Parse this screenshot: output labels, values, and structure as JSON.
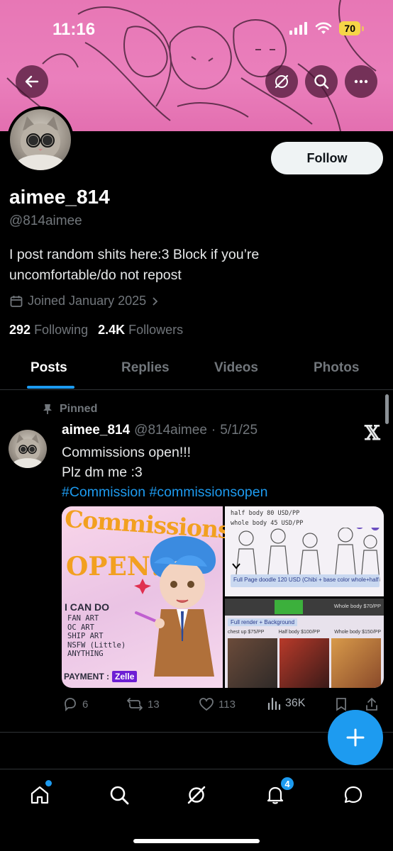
{
  "status_bar": {
    "time": "11:16",
    "battery": "70"
  },
  "profile": {
    "display_name": "aimee_814",
    "handle": "@814aimee",
    "bio_line1": "I post random shits here:3 Block if you’re",
    "bio_line2": "uncomfortable/do not repost",
    "joined": "Joined January 2025",
    "following_count": "292",
    "following_label": "Following",
    "followers_count": "2.4K",
    "followers_label": "Followers",
    "follow_button": "Follow"
  },
  "tabs": [
    "Posts",
    "Replies",
    "Videos",
    "Photos"
  ],
  "pinned_post": {
    "pinned_label": "Pinned",
    "author_name": "aimee_814",
    "author_handle": "@814aimee",
    "separator": "·",
    "date": "5/1/25",
    "line1": "Commissions open!!!",
    "line2": "Plz dm me :3",
    "hashtag1": "#Commission",
    "hashtag2": "#commissionsopen",
    "media": {
      "left_title_line1": "Commissions",
      "left_title_line2": "OPEN!",
      "left_list_heading": "I CAN DO",
      "left_list": [
        "FAN ART",
        "OC ART",
        "SHIP ART",
        "NSFW (Little)",
        "ANYTHING"
      ],
      "payment_label": "PAYMENT :",
      "payment_brand": "Zelle",
      "price_half_body": "half body  80 USD/PP",
      "price_whole_body": "whole body  45 USD/PP",
      "price_full_page": "Full Page doodle  120 USD (Chibi + base color whole+half body)",
      "price_whole_body_2": "Whole body $70/PP",
      "price_full_render": "Full render + Background",
      "price_chest_up": "chest up $75/PP",
      "price_half_body_2": "Half body $100/PP",
      "price_whole_body_3": "Whole body $150/PP"
    },
    "replies": "6",
    "reposts": "13",
    "likes": "113",
    "views": "36K"
  },
  "bottom_nav": {
    "notifications_badge": "4"
  },
  "colors": {
    "accent": "#1d9bf0",
    "banner": "#e777b5",
    "background": "#000000",
    "muted": "#71767b"
  }
}
